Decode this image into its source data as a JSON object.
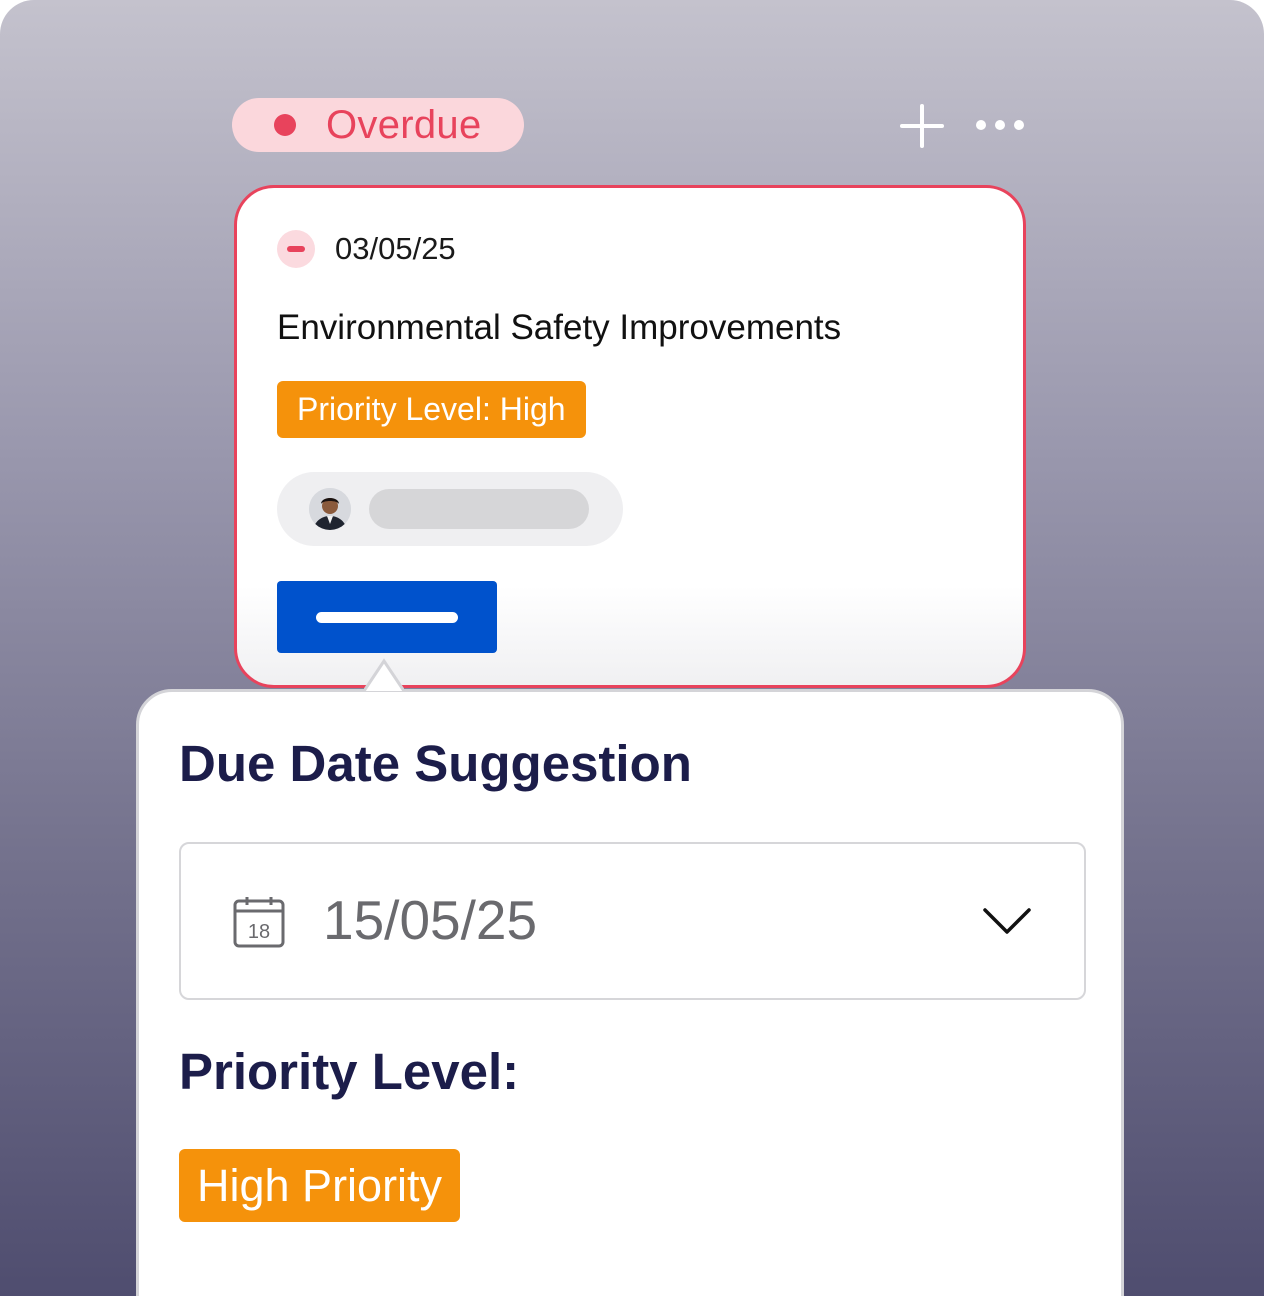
{
  "column": {
    "status_label": "Overdue",
    "status_color": "#e8435c",
    "add_icon": "plus-icon",
    "more_icon": "more-horizontal-icon"
  },
  "task_card": {
    "date": "03/05/25",
    "status_icon": "minus-circle-icon",
    "title": "Environmental Safety Improvements",
    "priority_tag": "Priority Level: High",
    "priority_color": "#f5920b",
    "action_button_color": "#0052cc"
  },
  "suggestion": {
    "title": "Due Date Suggestion",
    "date_value": "15/05/25",
    "calendar_icon_day": "18",
    "calendar_icon": "calendar-icon",
    "dropdown_icon": "chevron-down-icon",
    "priority_heading": "Priority Level:",
    "priority_badge": "High Priority"
  }
}
